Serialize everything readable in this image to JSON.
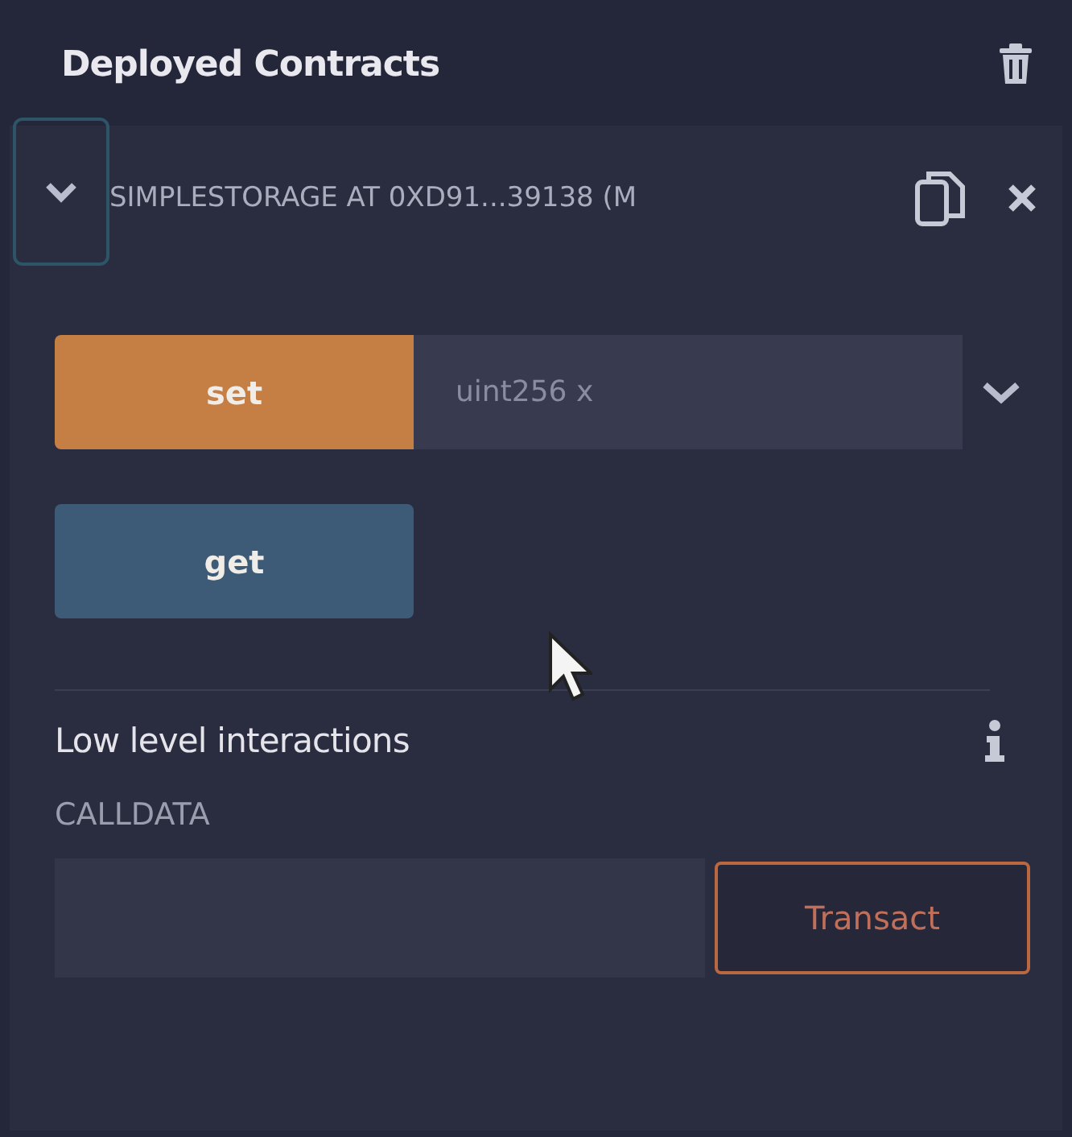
{
  "section": {
    "title": "Deployed Contracts"
  },
  "contract": {
    "expanded": true,
    "title": "SIMPLESTORAGE AT 0XD91...39138 (M",
    "functions": [
      {
        "kind": "transact",
        "label": "set",
        "placeholder": "uint256 x"
      },
      {
        "kind": "call",
        "label": "get"
      }
    ]
  },
  "low_level": {
    "title": "Low level interactions",
    "field_label": "CALLDATA",
    "button": "Transact"
  }
}
